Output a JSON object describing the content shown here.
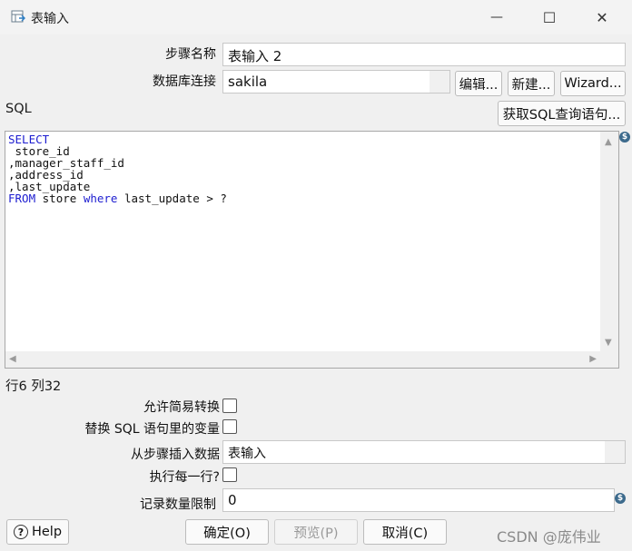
{
  "window": {
    "title": "表输入",
    "minimize": "—",
    "maximize": "☐",
    "close": "✕"
  },
  "form": {
    "step_name_label": "步骤名称",
    "step_name_value": "表输入 2",
    "db_conn_label": "数据库连接",
    "db_conn_value": "sakila",
    "edit_button": "编辑...",
    "new_button": "新建...",
    "wizard_button": "Wizard...",
    "sql_label": "SQL",
    "get_sql_button": "获取SQL查询语句..."
  },
  "sql": {
    "lines": [
      "SELECT",
      " store_id",
      ",manager_staff_id",
      ",address_id",
      ",last_update",
      "FROM store where last_update > ?"
    ],
    "keywords": [
      "SELECT",
      "FROM",
      "where"
    ]
  },
  "status": {
    "position": "行6 列32"
  },
  "options": {
    "lazy_conversion_label": "允许简易转换",
    "lazy_conversion_checked": false,
    "replace_vars_label": "替换 SQL 语句里的变量",
    "replace_vars_checked": false,
    "insert_from_step_label": "从步骤插入数据",
    "insert_from_step_value": "表输入",
    "execute_each_row_label": "执行每一行?",
    "execute_each_row_checked": false,
    "limit_label": "记录数量限制",
    "limit_value": "0"
  },
  "footer": {
    "help_button": "Help",
    "ok_button": "确定(O)",
    "preview_button": "预览(P)",
    "cancel_button": "取消(C)",
    "watermark": "CSDN @庞伟业"
  },
  "icons": {
    "variable_icon_glyph": "$",
    "help_icon_glyph": "?"
  }
}
